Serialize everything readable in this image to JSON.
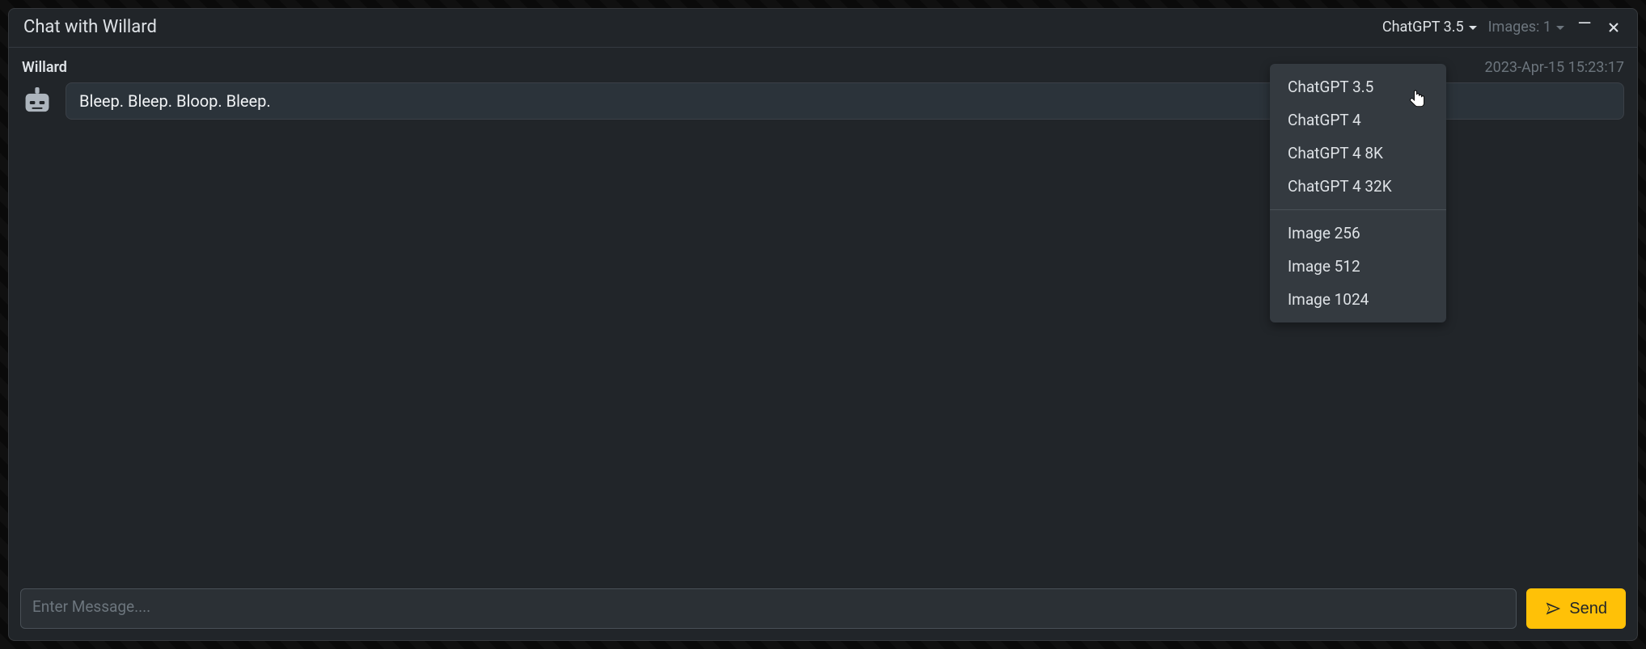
{
  "window": {
    "title": "Chat with Willard"
  },
  "controls": {
    "model_selected": "ChatGPT 3.5",
    "images_label": "Images: 1"
  },
  "dropdown": {
    "group1": [
      "ChatGPT 3.5",
      "ChatGPT 4",
      "ChatGPT 4 8K",
      "ChatGPT 4 32K"
    ],
    "group2": [
      "Image 256",
      "Image 512",
      "Image 1024"
    ]
  },
  "message": {
    "sender": "Willard",
    "timestamp": "2023-Apr-15 15:23:17",
    "text": "Bleep. Bleep. Bloop. Bleep."
  },
  "composer": {
    "placeholder": "Enter Message....",
    "send_label": "Send"
  }
}
